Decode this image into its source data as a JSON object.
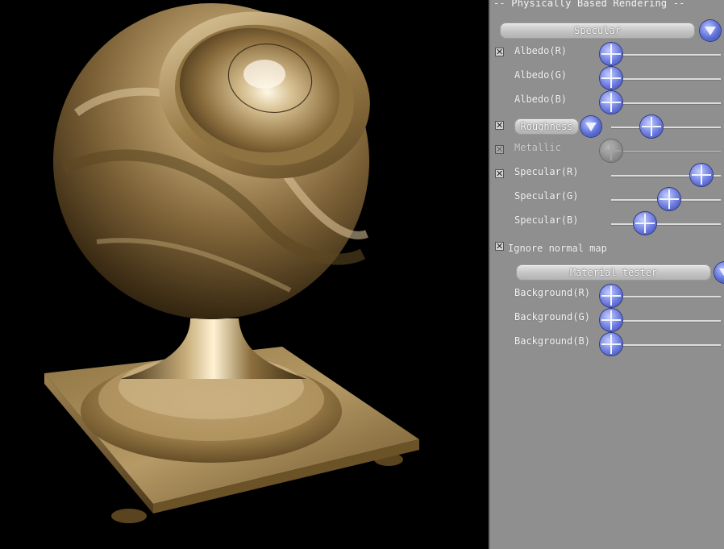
{
  "panel": {
    "title": "-- Physically Based Rendering --",
    "mode_combo": "Specular",
    "albedo_r": {
      "label": "Albedo(R)",
      "checked": true,
      "value": 0.0
    },
    "albedo_g": {
      "label": "Albedo(G)",
      "value": 0.0
    },
    "albedo_b": {
      "label": "Albedo(B)",
      "value": 0.0
    },
    "roughness": {
      "label": "Roughness",
      "checked": true,
      "value": 0.36
    },
    "metallic": {
      "label": "Metallic",
      "checked": false,
      "enabled": false,
      "value": 0.0
    },
    "specular_r": {
      "label": "Specular(R)",
      "checked": true,
      "value": 0.82
    },
    "specular_g": {
      "label": "Specular(G)",
      "value": 0.53
    },
    "specular_b": {
      "label": "Specular(B)",
      "value": 0.31
    },
    "ignore_normal_map": {
      "label": "Ignore normal map",
      "checked": true
    },
    "scene_combo": "Material tester",
    "background_r": {
      "label": "Background(R)",
      "value": 0.0
    },
    "background_g": {
      "label": "Background(G)",
      "value": 0.0
    },
    "background_b": {
      "label": "Background(B)",
      "value": 0.0
    },
    "check_mark": "✕"
  },
  "viewport": {
    "material_color": "#9a8152",
    "background_color": "#000000"
  }
}
